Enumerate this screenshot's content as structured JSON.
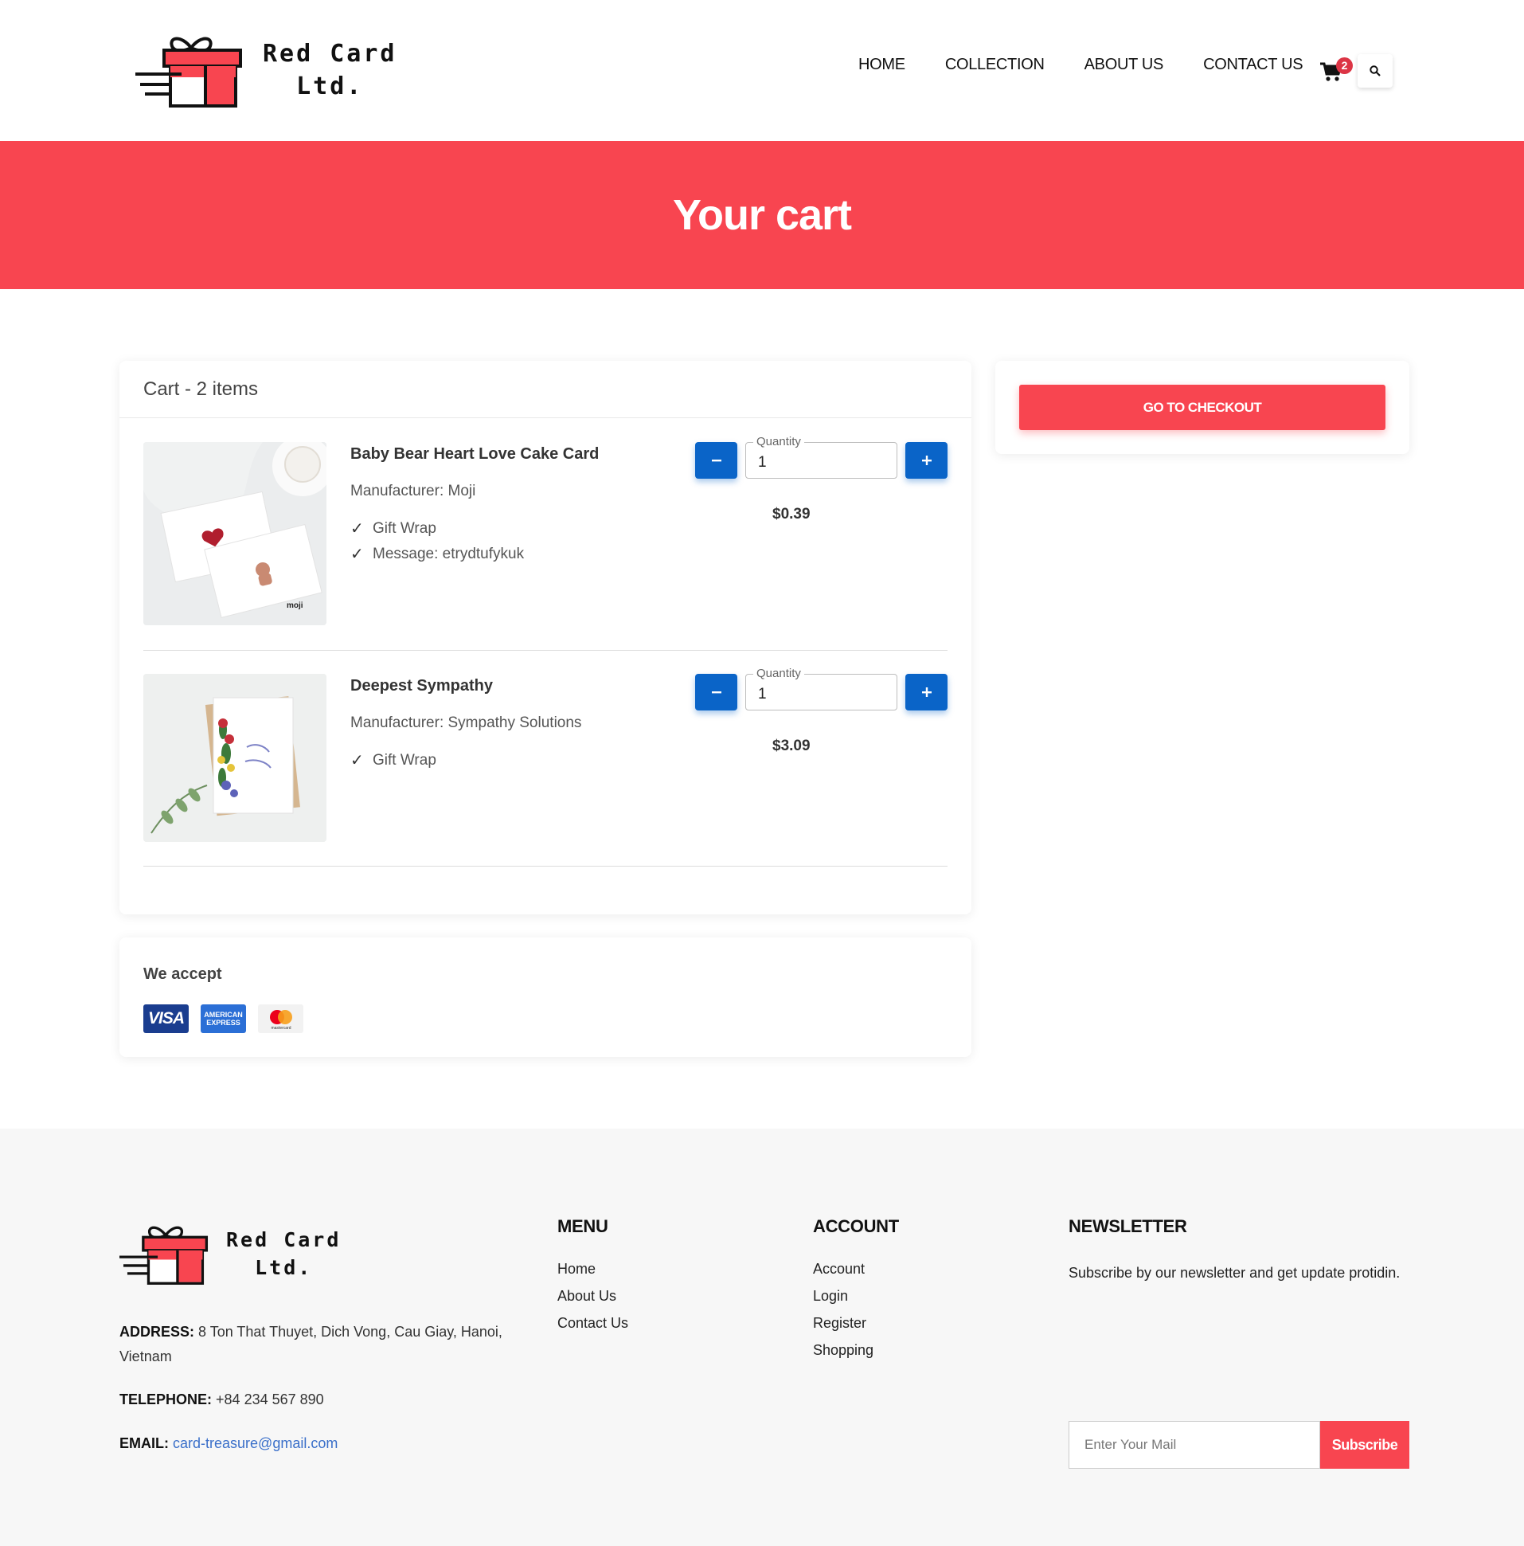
{
  "brand": {
    "line1": "Red Card",
    "line2": "Ltd."
  },
  "nav": {
    "items": [
      "HOME",
      "COLLECTION",
      "ABOUT US",
      "CONTACT US"
    ],
    "cart_count": "2"
  },
  "banner": {
    "title": "Your cart"
  },
  "cart": {
    "header": "Cart - 2 items",
    "quantity_label": "Quantity",
    "items": [
      {
        "name": "Baby Bear Heart Love Cake Card",
        "manufacturer": "Manufacturer: Moji",
        "options": [
          "Gift Wrap",
          "Message: etrydtufykuk"
        ],
        "quantity": "1",
        "price": "$0.39",
        "image_text": "moji"
      },
      {
        "name": "Deepest Sympathy",
        "manufacturer": "Manufacturer: Sympathy Solutions",
        "options": [
          "Gift Wrap"
        ],
        "quantity": "1",
        "price": "$3.09"
      }
    ]
  },
  "accept": {
    "title": "We accept",
    "cards": [
      {
        "name": "visa-icon",
        "text": "VISA"
      },
      {
        "name": "amex-icon",
        "text": "AMERICAN EXPRESS"
      },
      {
        "name": "mastercard-icon",
        "text": "mastercard"
      }
    ]
  },
  "checkout": {
    "label": "GO TO CHECKOUT"
  },
  "footer": {
    "address_label": "ADDRESS:",
    "address": "8 Ton That Thuyet, Dich Vong, Cau Giay, Hanoi, Vietnam",
    "telephone_label": "TELEPHONE:",
    "telephone": "+84 234 567 890",
    "email_label": "EMAIL:",
    "email": "card-treasure@gmail.com",
    "menu": {
      "title": "MENU",
      "links": [
        "Home",
        "About Us",
        "Contact Us"
      ]
    },
    "account": {
      "title": "ACCOUNT",
      "links": [
        "Account",
        "Login",
        "Register",
        "Shopping"
      ]
    },
    "newsletter": {
      "title": "NEWSLETTER",
      "text": "Subscribe by our newsletter and get update protidin.",
      "placeholder": "Enter Your Mail",
      "button": "Subscribe"
    }
  },
  "colors": {
    "accent": "#f84550",
    "primary_button": "#0a64c8",
    "badge": "#dc3545",
    "link": "#3a6fc9"
  }
}
